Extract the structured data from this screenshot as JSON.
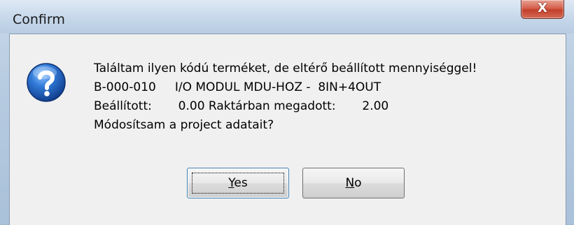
{
  "window": {
    "title": "Confirm",
    "close_label": "X"
  },
  "dialog": {
    "icon": "question-icon",
    "lines": [
      "Találtam ilyen kódú terméket, de eltérő beállított mennyiséggel!",
      "B-000-010     I/O MODUL MDU-HOZ -  8IN+4OUT",
      "Beállított:       0.00 Raktárban megadott:       2.00",
      "Módosítsam a project adatait?"
    ]
  },
  "buttons": {
    "yes_accel": "Y",
    "yes_rest": "es",
    "no_accel": "N",
    "no_rest": "o"
  },
  "colors": {
    "icon_blue": "#1f5fbf",
    "close_red": "#c3402b"
  }
}
